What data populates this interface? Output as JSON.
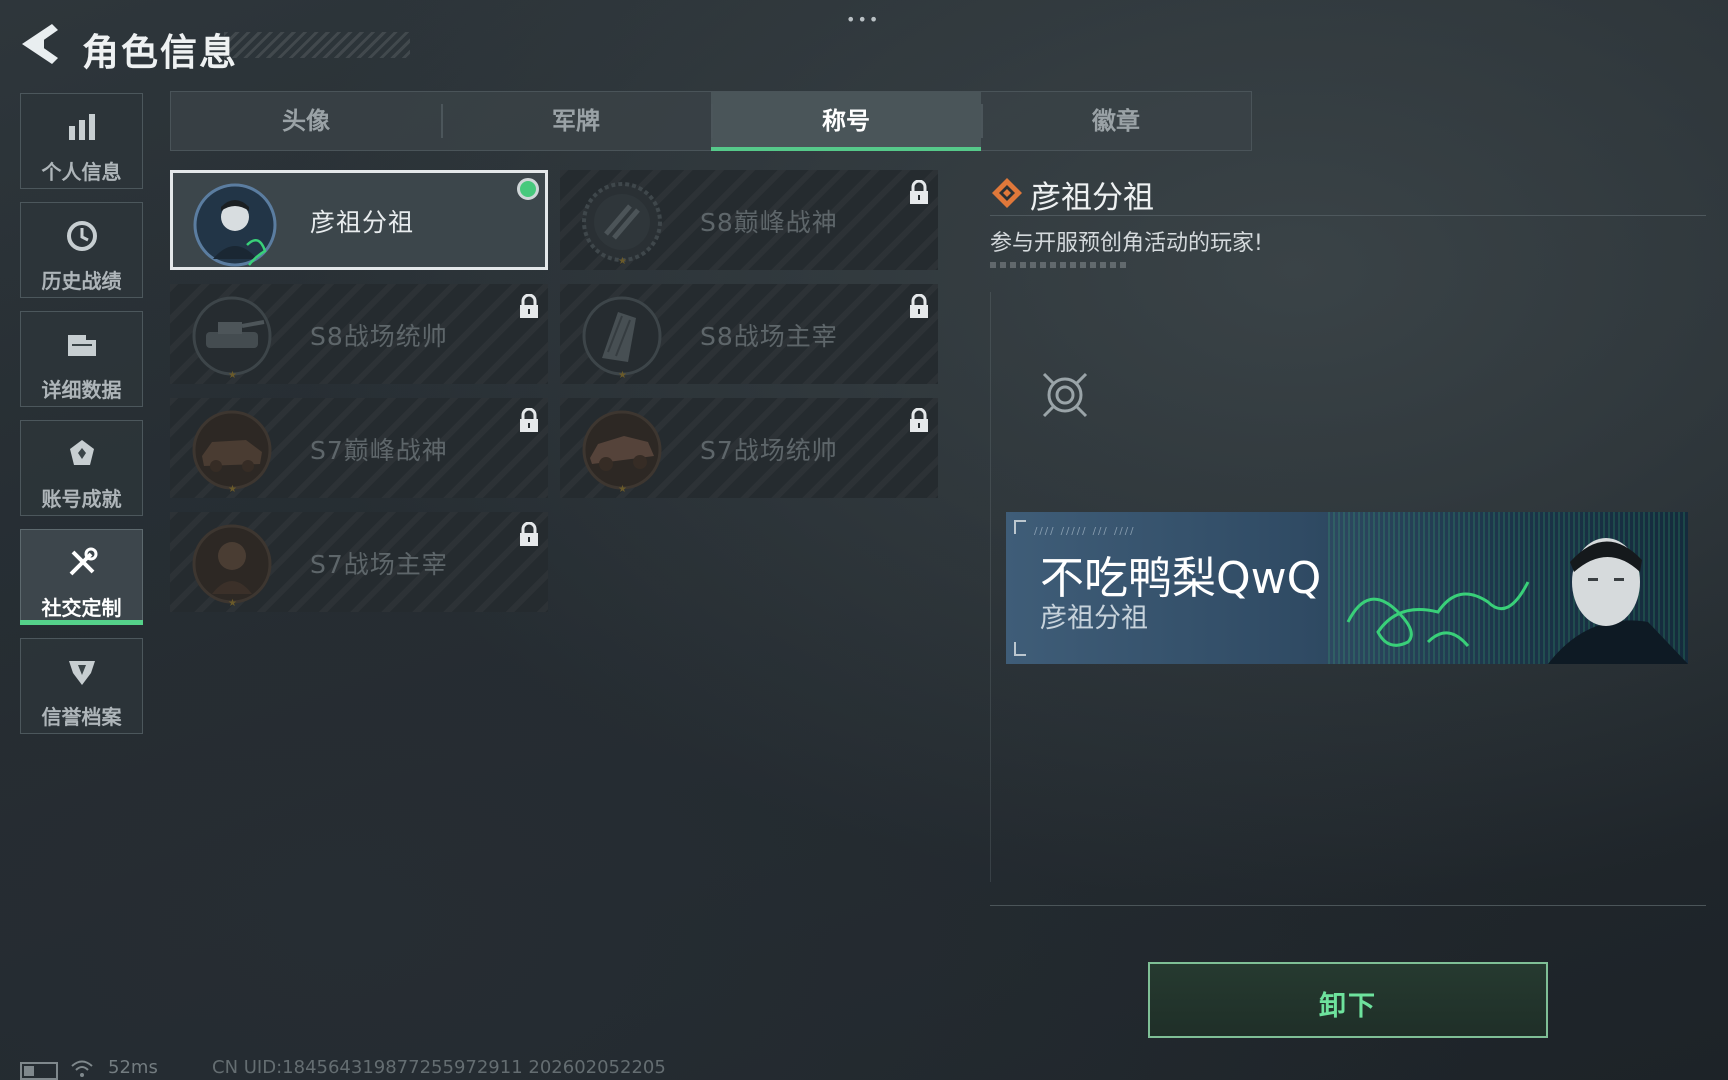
{
  "header": {
    "title": "角色信息",
    "more_icon": "more-dots-icon",
    "back_icon": "back-arrow-icon"
  },
  "sidebar": {
    "items": [
      {
        "label": "个人信息",
        "icon": "bar-chart-icon",
        "active": false
      },
      {
        "label": "历史战绩",
        "icon": "history-clock-icon",
        "active": false
      },
      {
        "label": "详细数据",
        "icon": "folder-icon",
        "active": false
      },
      {
        "label": "账号成就",
        "icon": "achievement-medal-icon",
        "active": false
      },
      {
        "label": "社交定制",
        "icon": "tools-icon",
        "active": true
      },
      {
        "label": "信誉档案",
        "icon": "credit-shield-icon",
        "active": false
      }
    ]
  },
  "tabs": [
    {
      "label": "头像",
      "active": false
    },
    {
      "label": "军牌",
      "active": false
    },
    {
      "label": "称号",
      "active": true
    },
    {
      "label": "徽章",
      "active": false
    }
  ],
  "titles": [
    {
      "label": "彦祖分祖",
      "locked": false,
      "selected": true,
      "badge": "portrait-badge-icon"
    },
    {
      "label": "S8巅峰战神",
      "locked": true,
      "selected": false,
      "badge": "emblem-badge-icon"
    },
    {
      "label": "S8战场统帅",
      "locked": true,
      "selected": false,
      "badge": "tank-badge-icon"
    },
    {
      "label": "S8战场主宰",
      "locked": true,
      "selected": false,
      "badge": "building-badge-icon"
    },
    {
      "label": "S7巅峰战神",
      "locked": true,
      "selected": false,
      "badge": "car-badge-icon"
    },
    {
      "label": "S7战场统帅",
      "locked": true,
      "selected": false,
      "badge": "vehicle-badge-icon"
    },
    {
      "label": "S7战场主宰",
      "locked": true,
      "selected": false,
      "badge": "soldier-badge-icon"
    }
  ],
  "detail": {
    "title": "彦祖分祖",
    "description": "参与开服预创角活动的玩家!",
    "banner": {
      "player_name": "不吃鸭梨QwQ",
      "title": "彦祖分祖"
    },
    "unequip_label": "卸下"
  },
  "footer": {
    "ping": "52ms",
    "uid": "CN UID:1845643198772559729​11 202602052205"
  },
  "colors": {
    "accent_green": "#56c98a",
    "background": "#252c31",
    "button_text": "#6ee29d",
    "detail_icon": "#e0783a"
  }
}
